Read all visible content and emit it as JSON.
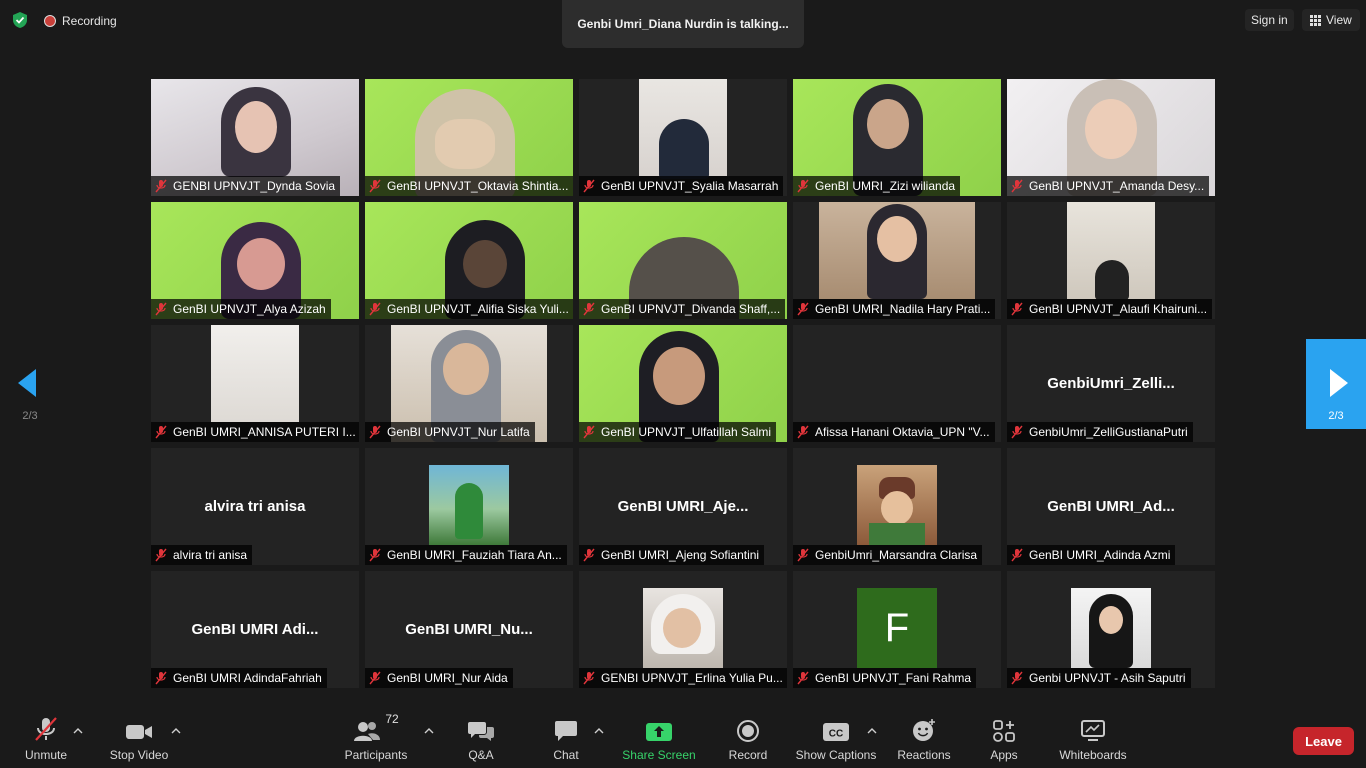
{
  "topbar": {
    "recording_label": "Recording",
    "talking_text": "Genbi Umri_Diana Nurdin is talking...",
    "signin_label": "Sign in",
    "view_label": "View"
  },
  "pager": {
    "left_page": "2/3",
    "right_page": "2/3"
  },
  "participants": [
    {
      "name": "GENBI UPNVJT_Dynda Sovia"
    },
    {
      "name": "GenBI UPNVJT_Oktavia Shintia..."
    },
    {
      "name": "GenBI UPNVJT_Syalia Masarrah"
    },
    {
      "name": "GenBI UMRI_Zizi wilianda"
    },
    {
      "name": "GenBI UPNVJT_Amanda Desy..."
    },
    {
      "name": "GenBI UPNVJT_Alya Azizah"
    },
    {
      "name": "GenBI UPNVJT_Alifia Siska Yuli..."
    },
    {
      "name": "GenBI UPNVJT_Divanda Shaff,..."
    },
    {
      "name": "GenBI UMRI_Nadila Hary Prati..."
    },
    {
      "name": "GenBI UPNVJT_Alaufi Khairuni..."
    },
    {
      "name": "GenBI UMRI_ANNISA PUTERI I..."
    },
    {
      "name": "GenBI UPNVJT_Nur Latifa"
    },
    {
      "name": "GenBI UPNVJT_Ulfatillah Salmi"
    },
    {
      "name": "Afissa Hanani Oktavia_UPN \"V..."
    },
    {
      "name": "GenbiUmri_ZelliGustianaPutri",
      "big": "GenbiUmri_Zelli..."
    },
    {
      "name": "alvira tri anisa",
      "big": "alvira tri anisa"
    },
    {
      "name": "GenBI UMRI_Fauziah Tiara An..."
    },
    {
      "name": "GenBI UMRI_Ajeng Sofiantini",
      "big": "GenBI UMRI_Aje..."
    },
    {
      "name": "GenbiUmri_Marsandra Clarisa"
    },
    {
      "name": "GenBI UMRI_Adinda Azmi",
      "big": "GenBI UMRI_Ad..."
    },
    {
      "name": "GenBI UMRI AdindaFahriah",
      "big": "GenBI UMRI Adi..."
    },
    {
      "name": "GenBI UMRI_Nur Aida",
      "big": "GenBI UMRI_Nu..."
    },
    {
      "name": "GENBI UPNVJT_Erlina Yulia Pu..."
    },
    {
      "name": "GenBI UPNVJT_Fani Rahma",
      "initial": "F"
    },
    {
      "name": "Genbi UPNVJT - Asih Saputri"
    }
  ],
  "toolbar": {
    "unmute": "Unmute",
    "stop_video": "Stop Video",
    "participants": "Participants",
    "participants_count": "72",
    "qa": "Q&A",
    "chat": "Chat",
    "share_screen": "Share Screen",
    "record": "Record",
    "show_captions": "Show Captions",
    "reactions": "Reactions",
    "apps": "Apps",
    "whiteboards": "Whiteboards",
    "leave": "Leave"
  },
  "colors": {
    "accent_blue": "#2aa3f0",
    "share_green": "#37d36a",
    "leave_red": "#c6252b",
    "mute_red": "#e0353b"
  }
}
